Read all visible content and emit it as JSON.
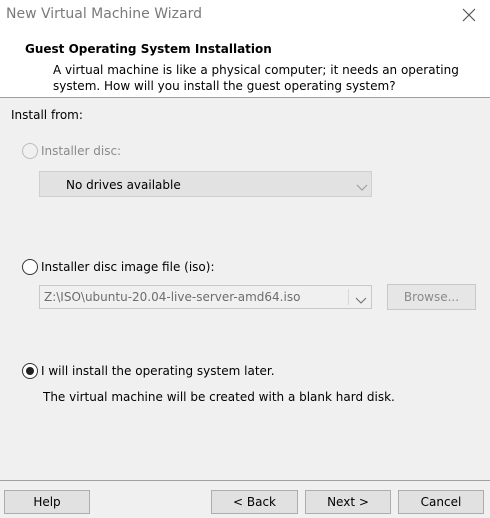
{
  "window": {
    "title": "New Virtual Machine Wizard"
  },
  "header": {
    "title": "Guest Operating System Installation",
    "description": "A virtual machine is like a physical computer; it needs an operating system. How will you install the guest operating system?"
  },
  "install_from_label": "Install from:",
  "options": {
    "installer_disc": {
      "label": "Installer disc:",
      "enabled": false,
      "selected": false,
      "dropdown_value": "No drives available"
    },
    "iso": {
      "label": "Installer disc image file (iso):",
      "enabled": true,
      "selected": false,
      "path_value": "Z:\\ISO\\ubuntu-20.04-live-server-amd64.iso",
      "browse_label": "Browse..."
    },
    "later": {
      "label": "I will install the operating system later.",
      "enabled": true,
      "selected": true,
      "description": "The virtual machine will be created with a blank hard disk."
    }
  },
  "buttons": {
    "help": "Help",
    "back": "< Back",
    "next": "Next >",
    "cancel": "Cancel"
  }
}
